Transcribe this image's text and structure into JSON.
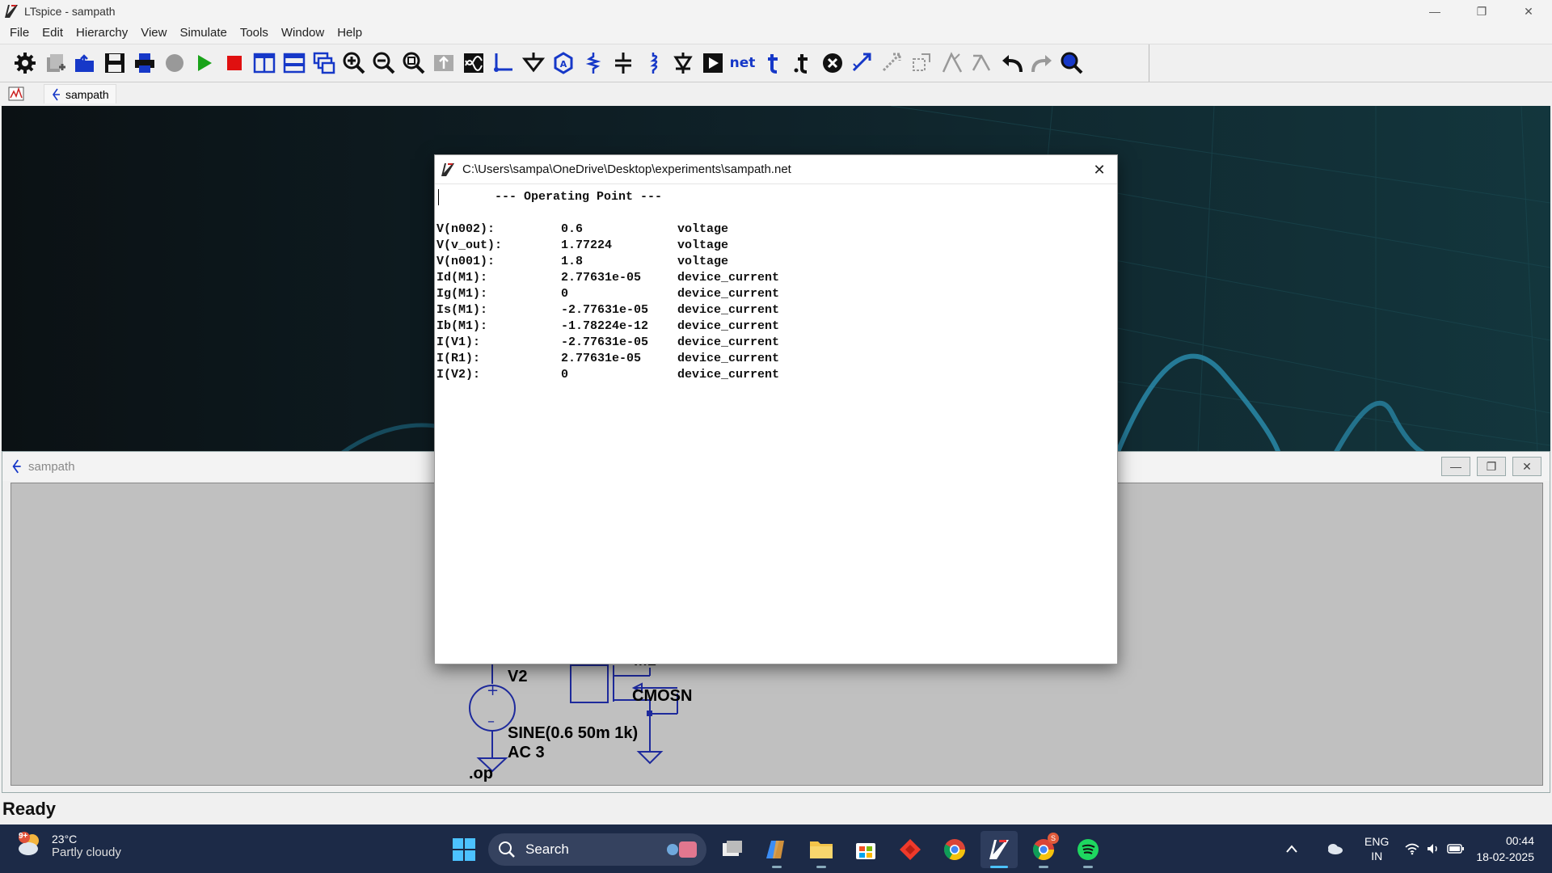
{
  "window": {
    "title": "LTspice - sampath",
    "controls": [
      "minimize",
      "restore",
      "close"
    ]
  },
  "menu": [
    "File",
    "Edit",
    "Hierarchy",
    "View",
    "Simulate",
    "Tools",
    "Window",
    "Help"
  ],
  "toolbar": {
    "net_label": "net",
    "icons": [
      "settings-icon",
      "new-schematic-icon",
      "open-icon",
      "save-icon",
      "print-icon",
      "stop-sim-icon",
      "run-icon",
      "halt-icon",
      "tile-vertical-icon",
      "tile-horizontal-icon",
      "cascade-icon",
      "zoom-in-icon",
      "zoom-out-icon",
      "zoom-fit-icon",
      "autorange-icon",
      "waveform-icon",
      "wire-icon",
      "ground-icon",
      "label-icon",
      "resistor-icon",
      "capacitor-icon",
      "inductor-icon",
      "diode-icon",
      "component-icon",
      "net-label-icon",
      "text-icon",
      "spice-directive-icon",
      "delete-icon",
      "move-icon",
      "drag-icon",
      "rotate-icon",
      "mirror-icon",
      "undo-icon",
      "redo-icon",
      "find-icon"
    ]
  },
  "tabs": {
    "active_tab": "sampath"
  },
  "schematic_window": {
    "title": "sampath",
    "labels": {
      "source_name": "V2",
      "source_value": "SINE(0.6 50m 1k)",
      "source_ac": "AC 3",
      "directive": ".op",
      "mos_model": "CMOSN",
      "mos_name_partial": "M1"
    }
  },
  "dialog": {
    "title": "C:\\Users\\sampa\\OneDrive\\Desktop\\experiments\\sampath.net",
    "header": "--- Operating Point ---",
    "rows": [
      {
        "name": "V(n002):",
        "value": "0.6",
        "type": "voltage"
      },
      {
        "name": "V(v_out):",
        "value": "1.77224",
        "type": "voltage"
      },
      {
        "name": "V(n001):",
        "value": "1.8",
        "type": "voltage"
      },
      {
        "name": "Id(M1):",
        "value": "2.77631e-05",
        "type": "device_current"
      },
      {
        "name": "Ig(M1):",
        "value": "0",
        "type": "device_current"
      },
      {
        "name": "Is(M1):",
        "value": "-2.77631e-05",
        "type": "device_current"
      },
      {
        "name": "Ib(M1):",
        "value": "-1.78224e-12",
        "type": "device_current"
      },
      {
        "name": "I(V1):",
        "value": "-2.77631e-05",
        "type": "device_current"
      },
      {
        "name": "I(R1):",
        "value": "2.77631e-05",
        "type": "device_current"
      },
      {
        "name": "I(V2):",
        "value": "0",
        "type": "device_current"
      }
    ]
  },
  "status": {
    "text": "Ready"
  },
  "taskbar": {
    "weather": {
      "temp": "23°C",
      "condition": "Partly cloudy",
      "badge": "9+"
    },
    "search_placeholder": "Search",
    "apps": [
      "file-explorer-icon",
      "task-view-icon",
      "copilot-icon",
      "folder-icon",
      "store-icon",
      "anydesk-icon",
      "chrome-icon",
      "ltspice-icon",
      "chrome-profile-icon",
      "spotify-icon"
    ],
    "chrome_badge": "S",
    "lang_line1": "ENG",
    "lang_line2": "IN",
    "time": "00:44",
    "date": "18-02-2025"
  },
  "colors": {
    "accent_blue": "#1638c8",
    "run_green": "#1aa31a",
    "halt_red": "#e01010",
    "taskbar": "#1c2a47",
    "schematic_bg": "#c0c0c0",
    "wire": "#1e2a9c"
  }
}
